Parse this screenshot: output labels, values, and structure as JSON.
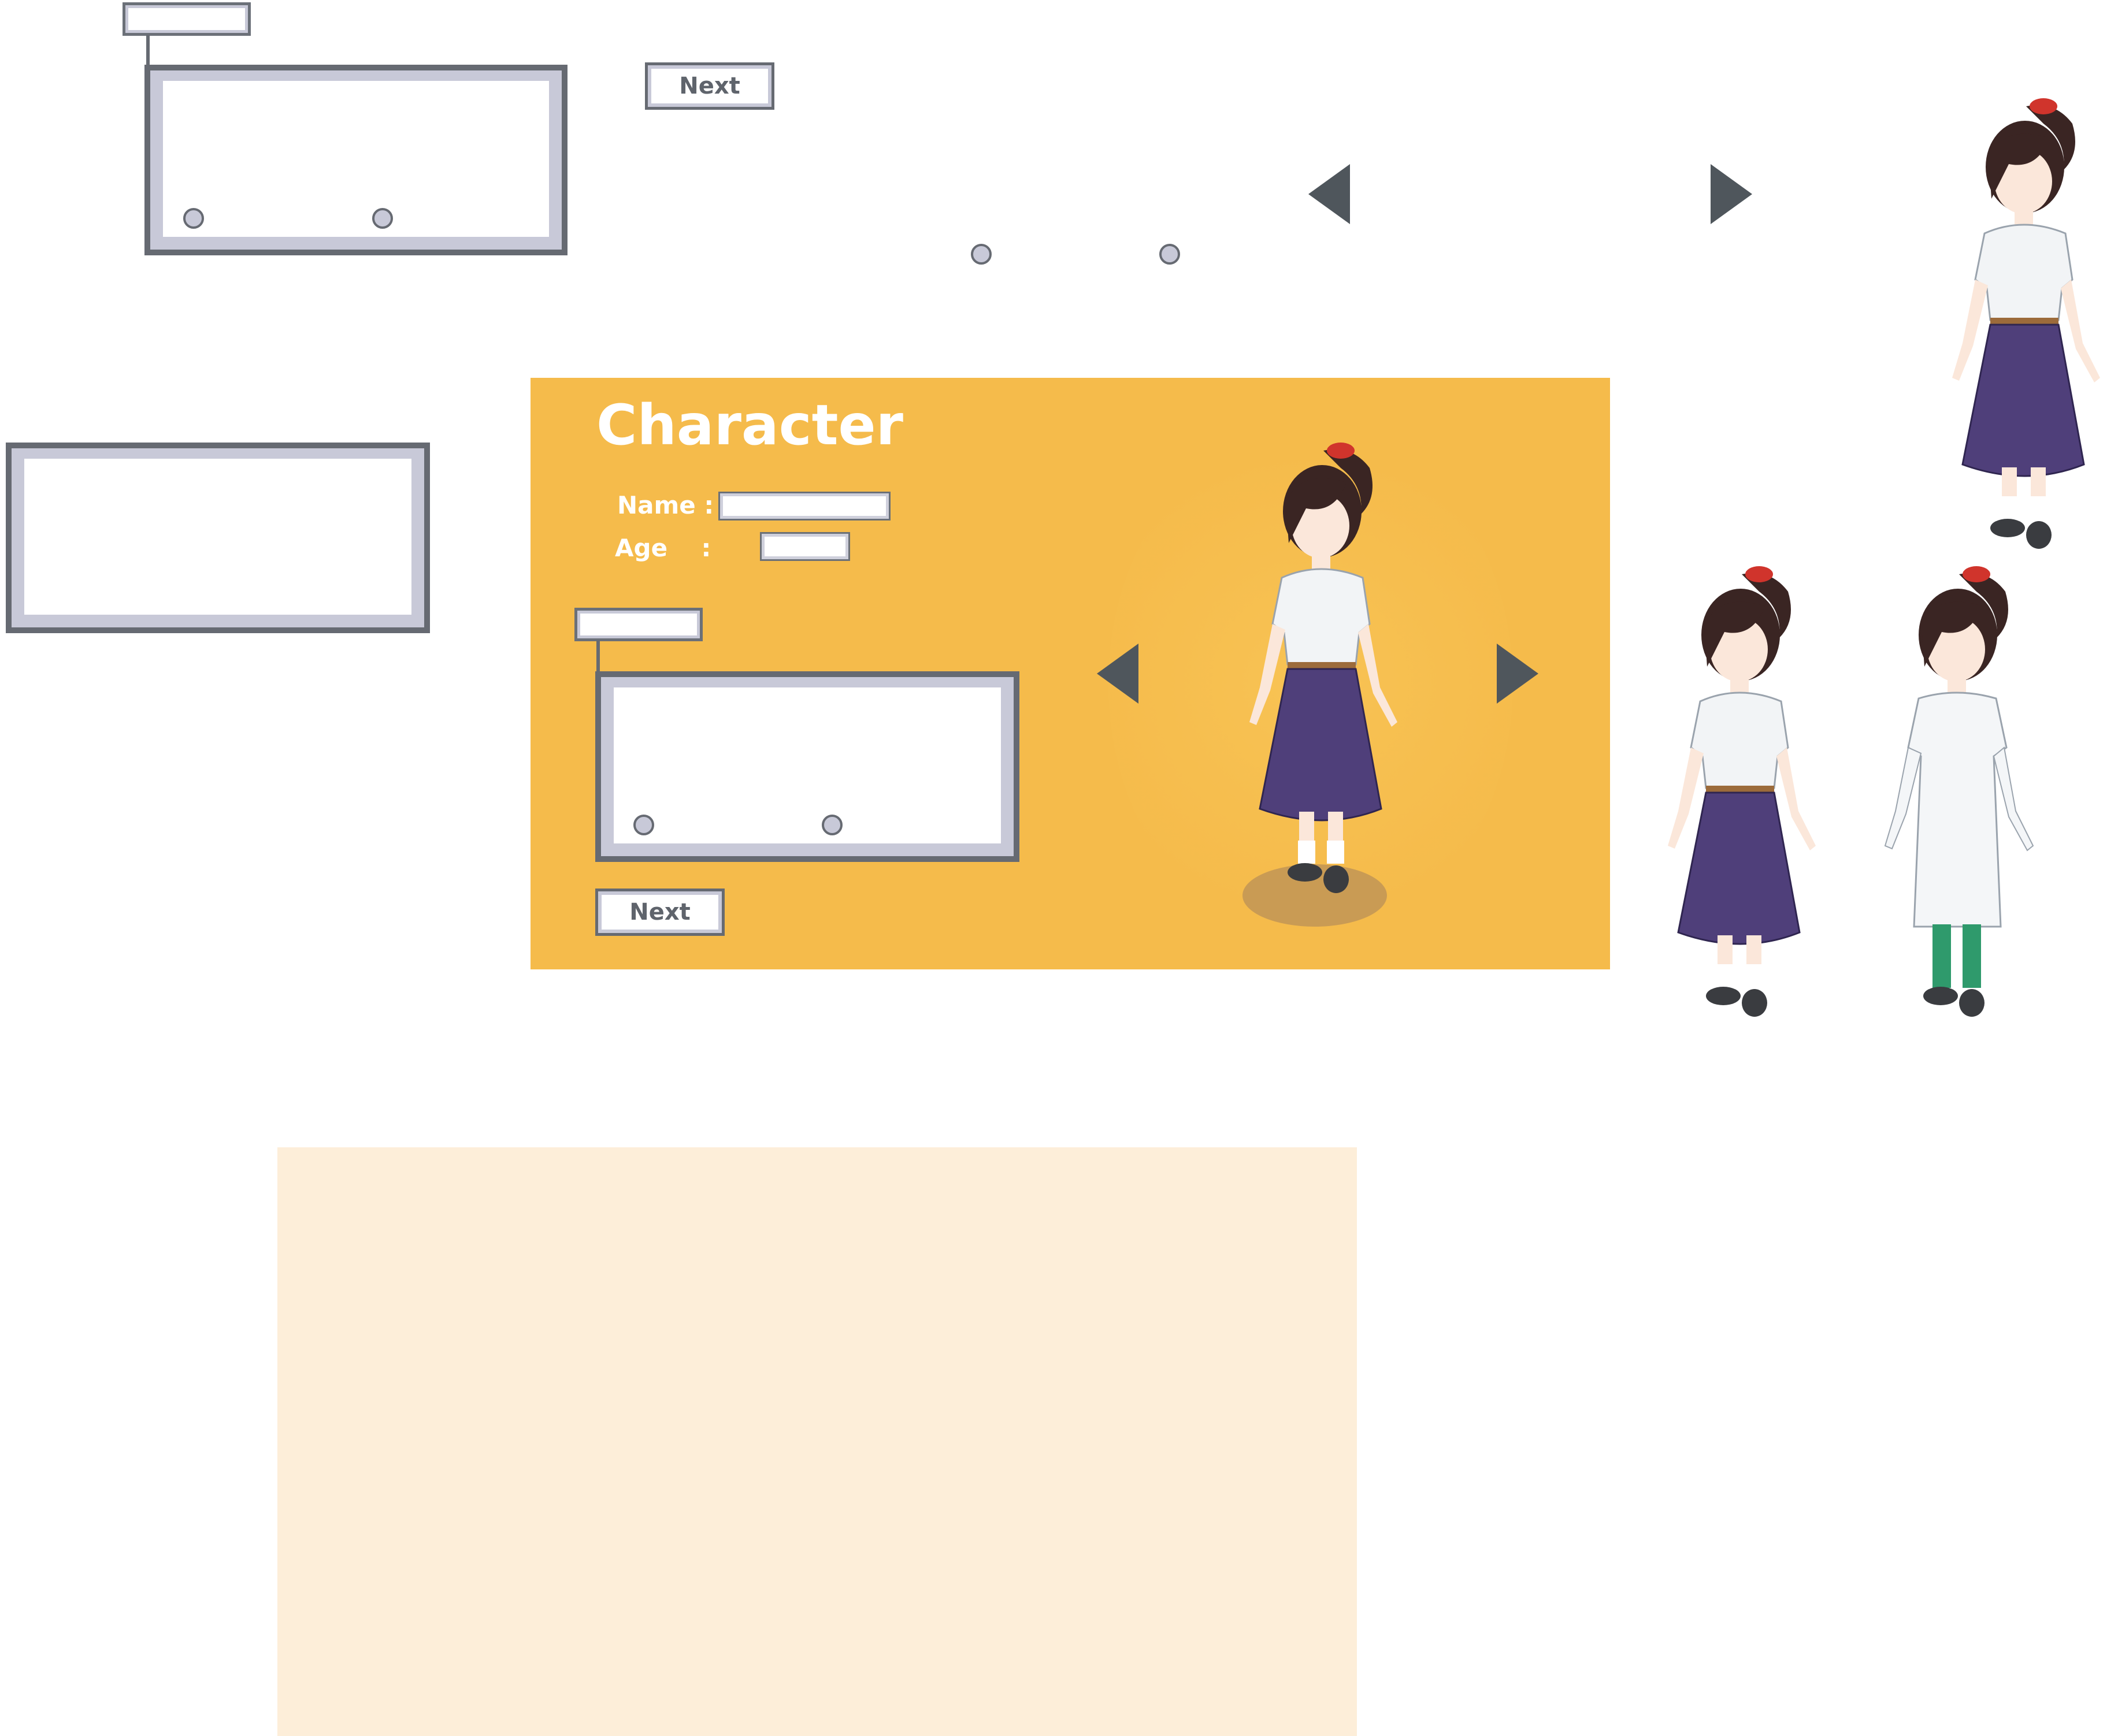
{
  "screen": {
    "title": "Character",
    "name_label": "Name :",
    "age_label": "Age    :",
    "next_label": "Next"
  },
  "loose_assets": {
    "next_label": "Next"
  },
  "colors": {
    "panel": "#f5bb4b",
    "cream_panel": "#fdeed9",
    "frame_dark": "#666a72",
    "frame_light": "#c8c9d8",
    "arrow": "#4f565c",
    "skirt": "#4f3f7a",
    "hair": "#3a2523",
    "ribbon": "#d0342c"
  },
  "icons": [
    "arrow-left-icon",
    "arrow-right-icon",
    "character-sprite-schoolgirl",
    "character-sprite-labcoat"
  ]
}
